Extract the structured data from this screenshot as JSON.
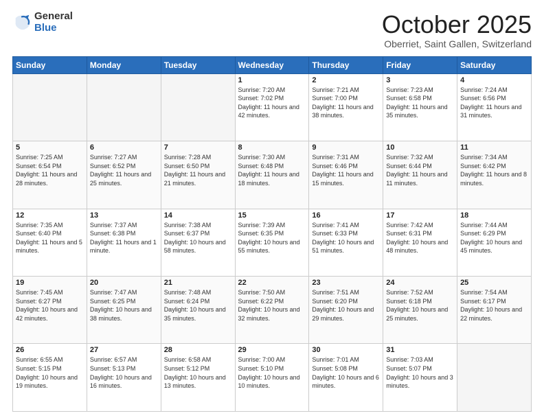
{
  "header": {
    "logo_general": "General",
    "logo_blue": "Blue",
    "month_title": "October 2025",
    "location": "Oberriet, Saint Gallen, Switzerland"
  },
  "weekdays": [
    "Sunday",
    "Monday",
    "Tuesday",
    "Wednesday",
    "Thursday",
    "Friday",
    "Saturday"
  ],
  "weeks": [
    [
      {
        "day": "",
        "sunrise": "",
        "sunset": "",
        "daylight": ""
      },
      {
        "day": "",
        "sunrise": "",
        "sunset": "",
        "daylight": ""
      },
      {
        "day": "",
        "sunrise": "",
        "sunset": "",
        "daylight": ""
      },
      {
        "day": "1",
        "sunrise": "Sunrise: 7:20 AM",
        "sunset": "Sunset: 7:02 PM",
        "daylight": "Daylight: 11 hours and 42 minutes."
      },
      {
        "day": "2",
        "sunrise": "Sunrise: 7:21 AM",
        "sunset": "Sunset: 7:00 PM",
        "daylight": "Daylight: 11 hours and 38 minutes."
      },
      {
        "day": "3",
        "sunrise": "Sunrise: 7:23 AM",
        "sunset": "Sunset: 6:58 PM",
        "daylight": "Daylight: 11 hours and 35 minutes."
      },
      {
        "day": "4",
        "sunrise": "Sunrise: 7:24 AM",
        "sunset": "Sunset: 6:56 PM",
        "daylight": "Daylight: 11 hours and 31 minutes."
      }
    ],
    [
      {
        "day": "5",
        "sunrise": "Sunrise: 7:25 AM",
        "sunset": "Sunset: 6:54 PM",
        "daylight": "Daylight: 11 hours and 28 minutes."
      },
      {
        "day": "6",
        "sunrise": "Sunrise: 7:27 AM",
        "sunset": "Sunset: 6:52 PM",
        "daylight": "Daylight: 11 hours and 25 minutes."
      },
      {
        "day": "7",
        "sunrise": "Sunrise: 7:28 AM",
        "sunset": "Sunset: 6:50 PM",
        "daylight": "Daylight: 11 hours and 21 minutes."
      },
      {
        "day": "8",
        "sunrise": "Sunrise: 7:30 AM",
        "sunset": "Sunset: 6:48 PM",
        "daylight": "Daylight: 11 hours and 18 minutes."
      },
      {
        "day": "9",
        "sunrise": "Sunrise: 7:31 AM",
        "sunset": "Sunset: 6:46 PM",
        "daylight": "Daylight: 11 hours and 15 minutes."
      },
      {
        "day": "10",
        "sunrise": "Sunrise: 7:32 AM",
        "sunset": "Sunset: 6:44 PM",
        "daylight": "Daylight: 11 hours and 11 minutes."
      },
      {
        "day": "11",
        "sunrise": "Sunrise: 7:34 AM",
        "sunset": "Sunset: 6:42 PM",
        "daylight": "Daylight: 11 hours and 8 minutes."
      }
    ],
    [
      {
        "day": "12",
        "sunrise": "Sunrise: 7:35 AM",
        "sunset": "Sunset: 6:40 PM",
        "daylight": "Daylight: 11 hours and 5 minutes."
      },
      {
        "day": "13",
        "sunrise": "Sunrise: 7:37 AM",
        "sunset": "Sunset: 6:38 PM",
        "daylight": "Daylight: 11 hours and 1 minute."
      },
      {
        "day": "14",
        "sunrise": "Sunrise: 7:38 AM",
        "sunset": "Sunset: 6:37 PM",
        "daylight": "Daylight: 10 hours and 58 minutes."
      },
      {
        "day": "15",
        "sunrise": "Sunrise: 7:39 AM",
        "sunset": "Sunset: 6:35 PM",
        "daylight": "Daylight: 10 hours and 55 minutes."
      },
      {
        "day": "16",
        "sunrise": "Sunrise: 7:41 AM",
        "sunset": "Sunset: 6:33 PM",
        "daylight": "Daylight: 10 hours and 51 minutes."
      },
      {
        "day": "17",
        "sunrise": "Sunrise: 7:42 AM",
        "sunset": "Sunset: 6:31 PM",
        "daylight": "Daylight: 10 hours and 48 minutes."
      },
      {
        "day": "18",
        "sunrise": "Sunrise: 7:44 AM",
        "sunset": "Sunset: 6:29 PM",
        "daylight": "Daylight: 10 hours and 45 minutes."
      }
    ],
    [
      {
        "day": "19",
        "sunrise": "Sunrise: 7:45 AM",
        "sunset": "Sunset: 6:27 PM",
        "daylight": "Daylight: 10 hours and 42 minutes."
      },
      {
        "day": "20",
        "sunrise": "Sunrise: 7:47 AM",
        "sunset": "Sunset: 6:25 PM",
        "daylight": "Daylight: 10 hours and 38 minutes."
      },
      {
        "day": "21",
        "sunrise": "Sunrise: 7:48 AM",
        "sunset": "Sunset: 6:24 PM",
        "daylight": "Daylight: 10 hours and 35 minutes."
      },
      {
        "day": "22",
        "sunrise": "Sunrise: 7:50 AM",
        "sunset": "Sunset: 6:22 PM",
        "daylight": "Daylight: 10 hours and 32 minutes."
      },
      {
        "day": "23",
        "sunrise": "Sunrise: 7:51 AM",
        "sunset": "Sunset: 6:20 PM",
        "daylight": "Daylight: 10 hours and 29 minutes."
      },
      {
        "day": "24",
        "sunrise": "Sunrise: 7:52 AM",
        "sunset": "Sunset: 6:18 PM",
        "daylight": "Daylight: 10 hours and 25 minutes."
      },
      {
        "day": "25",
        "sunrise": "Sunrise: 7:54 AM",
        "sunset": "Sunset: 6:17 PM",
        "daylight": "Daylight: 10 hours and 22 minutes."
      }
    ],
    [
      {
        "day": "26",
        "sunrise": "Sunrise: 6:55 AM",
        "sunset": "Sunset: 5:15 PM",
        "daylight": "Daylight: 10 hours and 19 minutes."
      },
      {
        "day": "27",
        "sunrise": "Sunrise: 6:57 AM",
        "sunset": "Sunset: 5:13 PM",
        "daylight": "Daylight: 10 hours and 16 minutes."
      },
      {
        "day": "28",
        "sunrise": "Sunrise: 6:58 AM",
        "sunset": "Sunset: 5:12 PM",
        "daylight": "Daylight: 10 hours and 13 minutes."
      },
      {
        "day": "29",
        "sunrise": "Sunrise: 7:00 AM",
        "sunset": "Sunset: 5:10 PM",
        "daylight": "Daylight: 10 hours and 10 minutes."
      },
      {
        "day": "30",
        "sunrise": "Sunrise: 7:01 AM",
        "sunset": "Sunset: 5:08 PM",
        "daylight": "Daylight: 10 hours and 6 minutes."
      },
      {
        "day": "31",
        "sunrise": "Sunrise: 7:03 AM",
        "sunset": "Sunset: 5:07 PM",
        "daylight": "Daylight: 10 hours and 3 minutes."
      },
      {
        "day": "",
        "sunrise": "",
        "sunset": "",
        "daylight": ""
      }
    ]
  ]
}
